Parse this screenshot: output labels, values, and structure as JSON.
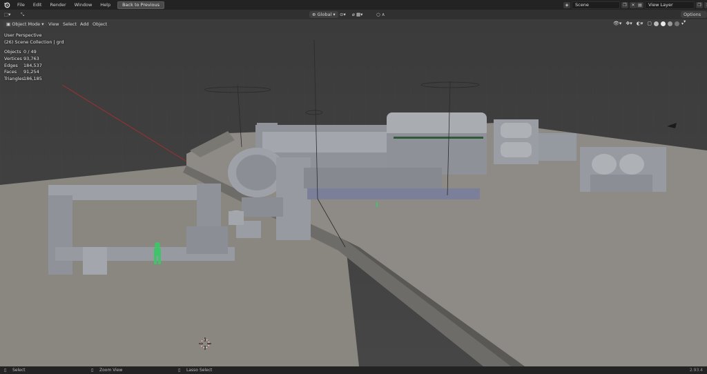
{
  "topbar": {
    "menus": [
      "File",
      "Edit",
      "Render",
      "Window",
      "Help"
    ],
    "back_button": "Back to Previous",
    "scene_label": "Scene",
    "view_layer_label": "View Layer"
  },
  "header": {
    "transform_orientation": "Global",
    "options_label": "Options"
  },
  "toolbar": {
    "mode": "Object Mode",
    "menus": [
      "View",
      "Select",
      "Add",
      "Object"
    ]
  },
  "viewport_overlay": {
    "perspective": "User Perspective",
    "collection": "(26) Scene Collection | grd"
  },
  "stats": [
    {
      "label": "Objects",
      "value": "0 / 49"
    },
    {
      "label": "Vertices",
      "value": "93,763"
    },
    {
      "label": "Edges",
      "value": "184,537"
    },
    {
      "label": "Faces",
      "value": "91,254"
    },
    {
      "label": "Triangles",
      "value": "186,185"
    }
  ],
  "statusbar": {
    "select": "Select",
    "zoom_view": "Zoom View",
    "lasso_select": "Lasso Select",
    "version": "2.93.4"
  },
  "colors": {
    "topbar_bg": "#232323",
    "header_bg": "#303030",
    "ground": "#8c8a85",
    "model": "#9a9ea4",
    "human_figure": "#3fc46a",
    "x_axis_line": "#a03030"
  },
  "icons": [
    "blender-logo-icon",
    "select-box-icon",
    "cursor-icon",
    "scene-icon",
    "view-layer-icon",
    "3d-cursor-icon"
  ]
}
